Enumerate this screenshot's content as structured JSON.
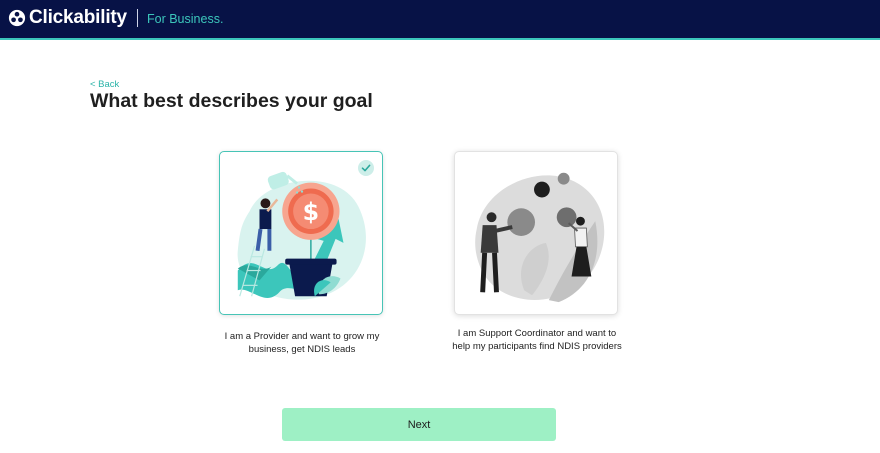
{
  "header": {
    "logo_text": "Clickability",
    "tagline": "For Business.",
    "colors": {
      "background": "#071246",
      "accent": "#3cc6bb"
    }
  },
  "nav": {
    "back_label": "< Back"
  },
  "page": {
    "title": "What best describes your goal"
  },
  "options": [
    {
      "label": "I am a Provider and want to grow my business, get NDIS leads",
      "selected": true,
      "illustration": "growth-money-plant-illustration"
    },
    {
      "label": "I am Support Coordinator and want to help my participants find NDIS providers",
      "selected": false,
      "illustration": "people-with-circles-illustration"
    }
  ],
  "actions": {
    "next_label": "Next",
    "next_color": "#9ef0c5"
  },
  "icons": {
    "logo": "clickability-logo-icon",
    "check": "check-icon"
  }
}
